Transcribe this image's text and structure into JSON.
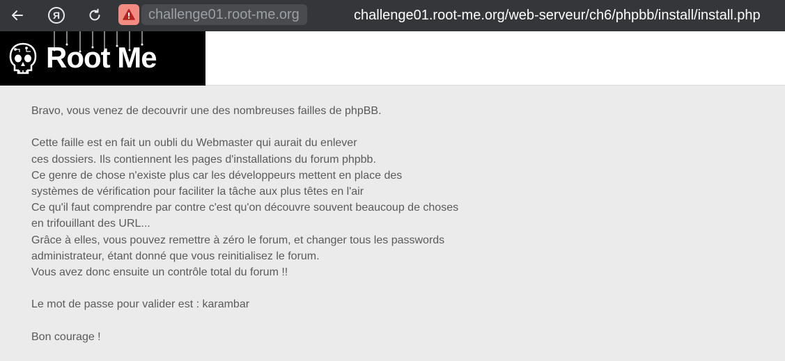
{
  "browser": {
    "domain": "challenge01.root-me.org",
    "url": "challenge01.root-me.org/web-serveur/ch6/phpbb/install/install.php",
    "yandex_glyph": "Я"
  },
  "header": {
    "logo_text": "Root Me",
    "logo_bg": "#000000"
  },
  "content": {
    "intro": "Bravo, vous venez de decouvrir une des nombreuses failles de phpBB.",
    "body_lines": [
      "Cette faille est en fait un oubli du Webmaster qui aurait du enlever",
      "ces dossiers. Ils contiennent les pages d'installations du forum phpbb.",
      "Ce genre de chose n'existe plus car les développeurs mettent en place des",
      "systèmes de vérification pour faciliter la tâche aux plus têtes en l'air",
      "Ce qu'il faut comprendre par contre c'est qu'on découvre souvent beaucoup de choses",
      "en trifouillant des URL...",
      "Grâce à elles, vous pouvez remettre à zéro le forum, et changer tous les passwords",
      "administrateur, étant donné que vous reinitialisez le forum.",
      "Vous avez donc ensuite un contrôle total du forum !!"
    ],
    "password_line": "Le mot de passe pour valider est : karambar",
    "closing": "Bon courage !"
  },
  "colors": {
    "toolbar": "#35363a",
    "page_bg": "#ebebeb",
    "text": "#5a5a5a",
    "warning": "#f28b82"
  },
  "icons": {
    "back": "back-arrow-icon",
    "yandex": "yandex-icon",
    "reload": "reload-icon",
    "warning": "warning-icon",
    "logo": "skull-icon"
  }
}
